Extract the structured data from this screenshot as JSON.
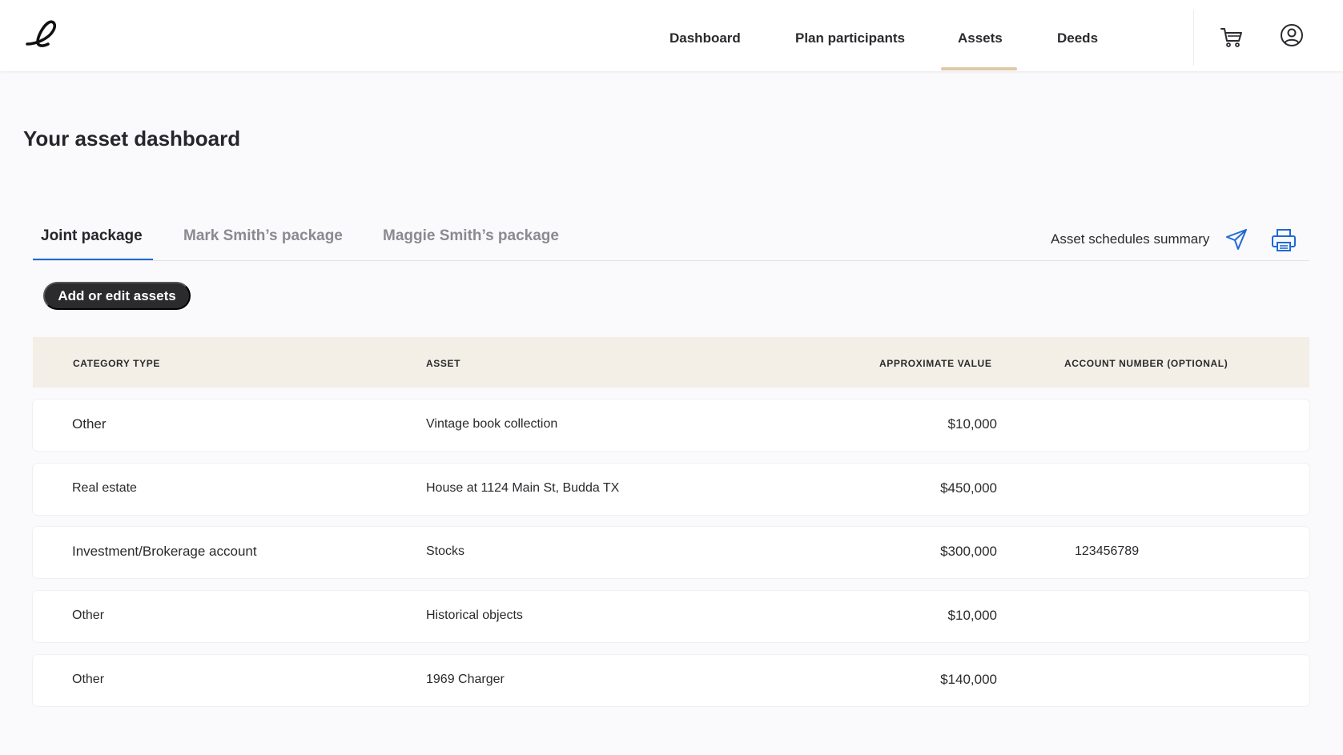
{
  "header": {
    "logo_text": "e",
    "nav": [
      {
        "label": "Dashboard"
      },
      {
        "label": "Plan participants"
      },
      {
        "label": "Assets",
        "active": true
      },
      {
        "label": "Deeds"
      }
    ],
    "icons": [
      "cart-icon",
      "account-icon"
    ],
    "accent_color": "#e0c9a6"
  },
  "page": {
    "title": "Your asset dashboard"
  },
  "tabs": [
    {
      "label": "Joint package",
      "active": true
    },
    {
      "label": "Mark Smith’s package"
    },
    {
      "label": "Maggie Smith’s package"
    }
  ],
  "summary": {
    "label": "Asset schedules summary",
    "icons": [
      "send-icon",
      "print-icon"
    ],
    "icon_color": "#1e6ad3"
  },
  "actions": {
    "add_edit_label": "Add or edit assets"
  },
  "table": {
    "columns": [
      "CATEGORY TYPE",
      "ASSET",
      "APPROXIMATE VALUE",
      "ACCOUNT NUMBER (OPTIONAL)"
    ],
    "rows": [
      {
        "category": "Other",
        "asset": "Vintage book collection",
        "value": "$10,000",
        "account": ""
      },
      {
        "category": "Real estate",
        "asset": "House at 1124 Main St, Budda TX",
        "value": "$450,000",
        "account": ""
      },
      {
        "category": "Investment/Brokerage account",
        "asset": "Stocks",
        "value": "$300,000",
        "account": "123456789"
      },
      {
        "category": "Other",
        "asset": "Historical objects",
        "value": "$10,000",
        "account": ""
      },
      {
        "category": "Other",
        "asset": "1969 Charger",
        "value": "$140,000",
        "account": ""
      }
    ]
  }
}
